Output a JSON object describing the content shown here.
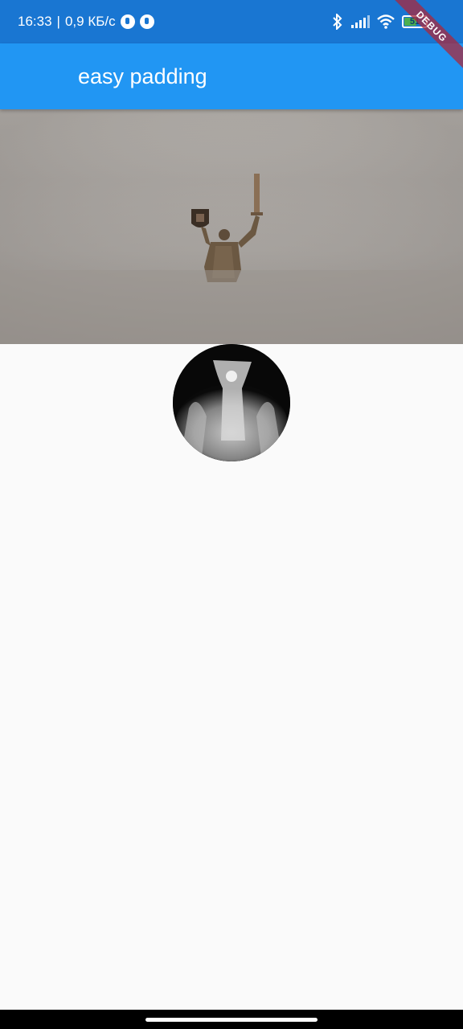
{
  "status_bar": {
    "time": "16:33",
    "separator": "|",
    "network_speed": "0,9 КБ/с",
    "battery_level": "51",
    "icons": [
      "notification-icon",
      "notification-icon",
      "bluetooth-icon",
      "signal-icon",
      "wifi-icon",
      "battery-icon"
    ]
  },
  "debug_banner": {
    "label": "DEBUG"
  },
  "app_bar": {
    "title": "easy padding"
  },
  "colors": {
    "status_bar": "#1976d2",
    "app_bar": "#2196f3",
    "background": "#fafafa"
  }
}
